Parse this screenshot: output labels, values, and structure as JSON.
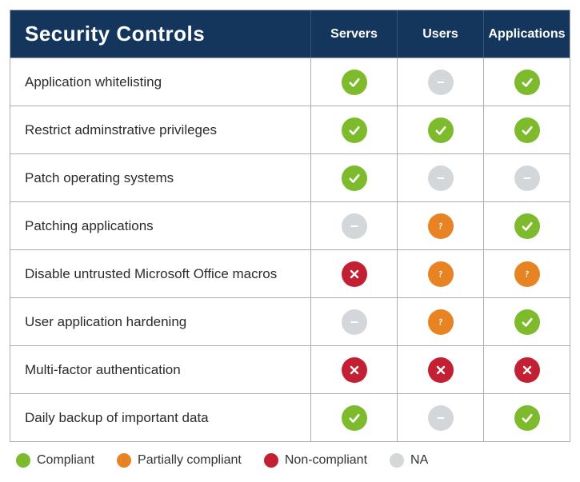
{
  "title": "Security Controls",
  "columns": [
    "Servers",
    "Users",
    "Applications"
  ],
  "rows": [
    {
      "label": "Application whitelisting",
      "status": [
        "compliant",
        "na",
        "compliant"
      ]
    },
    {
      "label": "Restrict adminstrative privileges",
      "status": [
        "compliant",
        "compliant",
        "compliant"
      ]
    },
    {
      "label": "Patch operating systems",
      "status": [
        "compliant",
        "na",
        "na"
      ]
    },
    {
      "label": "Patching applications",
      "status": [
        "na",
        "partial",
        "compliant"
      ]
    },
    {
      "label": "Disable untrusted Microsoft Office macros",
      "status": [
        "noncomp",
        "partial",
        "partial"
      ]
    },
    {
      "label": "User application hardening",
      "status": [
        "na",
        "partial",
        "compliant"
      ]
    },
    {
      "label": "Multi-factor authentication",
      "status": [
        "noncomp",
        "noncomp",
        "noncomp"
      ]
    },
    {
      "label": "Daily backup of important data",
      "status": [
        "compliant",
        "na",
        "compliant"
      ]
    }
  ],
  "legend": [
    {
      "key": "compliant",
      "label": "Compliant"
    },
    {
      "key": "partial",
      "label": "Partially compliant"
    },
    {
      "key": "noncomp",
      "label": "Non-compliant"
    },
    {
      "key": "na",
      "label": "NA"
    }
  ],
  "status_meta": {
    "compliant": {
      "icon": "check",
      "color": "#7dbb2d"
    },
    "partial": {
      "icon": "question",
      "color": "#e88324"
    },
    "noncomp": {
      "icon": "cross",
      "color": "#c42033"
    },
    "na": {
      "icon": "dash",
      "color": "#d4d7da"
    }
  }
}
